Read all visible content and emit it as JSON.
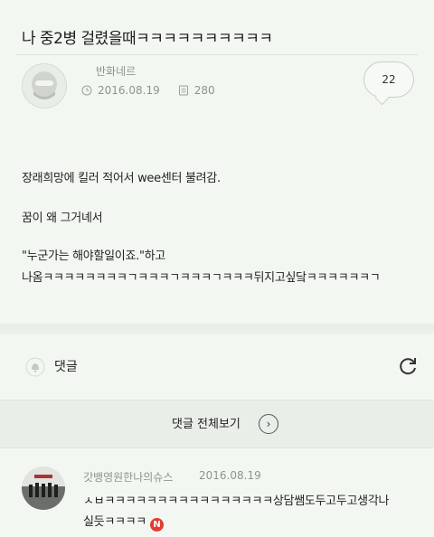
{
  "post": {
    "title": "나 중2병 걸렸을때ㅋㅋㅋㅋㅋㅋㅋㅋㅋㅋ",
    "author": "반화네르",
    "date": "2016.08.19",
    "views": "280",
    "comment_count": "22",
    "body": [
      "장래희망에 킬러 적어서 wee센터 불려감.",
      "꿈이 왜 그거녜서",
      "\"누군가는 해야할일이죠.\"하고",
      "나옴ㅋㅋㅋㅋㅋㅋㅋㅋㄱㅋㅋㅋㄱㅋㅋㅋㄱㅋㅋㅋ뒤지고싶닼ㅋㅋㅋㅋㅋㅋㄱ"
    ]
  },
  "comments_section": {
    "label": "댓글",
    "view_all_label": "댓글 전체보기"
  },
  "comment": {
    "author": "갓뱅영원한나의슈스",
    "date": "2016.08.19",
    "lines": [
      "ㅅㅂㅋㅋㅋㅋㅋㅋㅋㅋㅋㅋㅋㅋㅋㅋㅋㅋ상담쌤도두고두고생각나",
      "실듯ㅋㅋㅋㅋ"
    ],
    "new_badge": "N"
  },
  "colors": {
    "background": "#f3f7f2",
    "new_badge": "#e23d2f"
  }
}
